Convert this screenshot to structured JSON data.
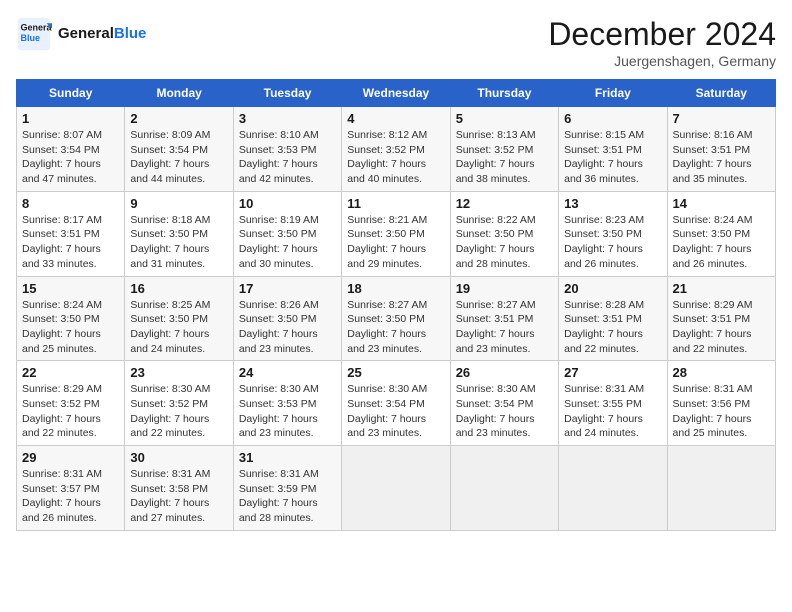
{
  "header": {
    "logo_line1": "General",
    "logo_line2": "Blue",
    "month": "December 2024",
    "location": "Juergenshagen, Germany"
  },
  "weekdays": [
    "Sunday",
    "Monday",
    "Tuesday",
    "Wednesday",
    "Thursday",
    "Friday",
    "Saturday"
  ],
  "weeks": [
    [
      {
        "day": "1",
        "info": "Sunrise: 8:07 AM\nSunset: 3:54 PM\nDaylight: 7 hours\nand 47 minutes."
      },
      {
        "day": "2",
        "info": "Sunrise: 8:09 AM\nSunset: 3:54 PM\nDaylight: 7 hours\nand 44 minutes."
      },
      {
        "day": "3",
        "info": "Sunrise: 8:10 AM\nSunset: 3:53 PM\nDaylight: 7 hours\nand 42 minutes."
      },
      {
        "day": "4",
        "info": "Sunrise: 8:12 AM\nSunset: 3:52 PM\nDaylight: 7 hours\nand 40 minutes."
      },
      {
        "day": "5",
        "info": "Sunrise: 8:13 AM\nSunset: 3:52 PM\nDaylight: 7 hours\nand 38 minutes."
      },
      {
        "day": "6",
        "info": "Sunrise: 8:15 AM\nSunset: 3:51 PM\nDaylight: 7 hours\nand 36 minutes."
      },
      {
        "day": "7",
        "info": "Sunrise: 8:16 AM\nSunset: 3:51 PM\nDaylight: 7 hours\nand 35 minutes."
      }
    ],
    [
      {
        "day": "8",
        "info": "Sunrise: 8:17 AM\nSunset: 3:51 PM\nDaylight: 7 hours\nand 33 minutes."
      },
      {
        "day": "9",
        "info": "Sunrise: 8:18 AM\nSunset: 3:50 PM\nDaylight: 7 hours\nand 31 minutes."
      },
      {
        "day": "10",
        "info": "Sunrise: 8:19 AM\nSunset: 3:50 PM\nDaylight: 7 hours\nand 30 minutes."
      },
      {
        "day": "11",
        "info": "Sunrise: 8:21 AM\nSunset: 3:50 PM\nDaylight: 7 hours\nand 29 minutes."
      },
      {
        "day": "12",
        "info": "Sunrise: 8:22 AM\nSunset: 3:50 PM\nDaylight: 7 hours\nand 28 minutes."
      },
      {
        "day": "13",
        "info": "Sunrise: 8:23 AM\nSunset: 3:50 PM\nDaylight: 7 hours\nand 26 minutes."
      },
      {
        "day": "14",
        "info": "Sunrise: 8:24 AM\nSunset: 3:50 PM\nDaylight: 7 hours\nand 26 minutes."
      }
    ],
    [
      {
        "day": "15",
        "info": "Sunrise: 8:24 AM\nSunset: 3:50 PM\nDaylight: 7 hours\nand 25 minutes."
      },
      {
        "day": "16",
        "info": "Sunrise: 8:25 AM\nSunset: 3:50 PM\nDaylight: 7 hours\nand 24 minutes."
      },
      {
        "day": "17",
        "info": "Sunrise: 8:26 AM\nSunset: 3:50 PM\nDaylight: 7 hours\nand 23 minutes."
      },
      {
        "day": "18",
        "info": "Sunrise: 8:27 AM\nSunset: 3:50 PM\nDaylight: 7 hours\nand 23 minutes."
      },
      {
        "day": "19",
        "info": "Sunrise: 8:27 AM\nSunset: 3:51 PM\nDaylight: 7 hours\nand 23 minutes."
      },
      {
        "day": "20",
        "info": "Sunrise: 8:28 AM\nSunset: 3:51 PM\nDaylight: 7 hours\nand 22 minutes."
      },
      {
        "day": "21",
        "info": "Sunrise: 8:29 AM\nSunset: 3:51 PM\nDaylight: 7 hours\nand 22 minutes."
      }
    ],
    [
      {
        "day": "22",
        "info": "Sunrise: 8:29 AM\nSunset: 3:52 PM\nDaylight: 7 hours\nand 22 minutes."
      },
      {
        "day": "23",
        "info": "Sunrise: 8:30 AM\nSunset: 3:52 PM\nDaylight: 7 hours\nand 22 minutes."
      },
      {
        "day": "24",
        "info": "Sunrise: 8:30 AM\nSunset: 3:53 PM\nDaylight: 7 hours\nand 23 minutes."
      },
      {
        "day": "25",
        "info": "Sunrise: 8:30 AM\nSunset: 3:54 PM\nDaylight: 7 hours\nand 23 minutes."
      },
      {
        "day": "26",
        "info": "Sunrise: 8:30 AM\nSunset: 3:54 PM\nDaylight: 7 hours\nand 23 minutes."
      },
      {
        "day": "27",
        "info": "Sunrise: 8:31 AM\nSunset: 3:55 PM\nDaylight: 7 hours\nand 24 minutes."
      },
      {
        "day": "28",
        "info": "Sunrise: 8:31 AM\nSunset: 3:56 PM\nDaylight: 7 hours\nand 25 minutes."
      }
    ],
    [
      {
        "day": "29",
        "info": "Sunrise: 8:31 AM\nSunset: 3:57 PM\nDaylight: 7 hours\nand 26 minutes."
      },
      {
        "day": "30",
        "info": "Sunrise: 8:31 AM\nSunset: 3:58 PM\nDaylight: 7 hours\nand 27 minutes."
      },
      {
        "day": "31",
        "info": "Sunrise: 8:31 AM\nSunset: 3:59 PM\nDaylight: 7 hours\nand 28 minutes."
      },
      null,
      null,
      null,
      null
    ]
  ]
}
